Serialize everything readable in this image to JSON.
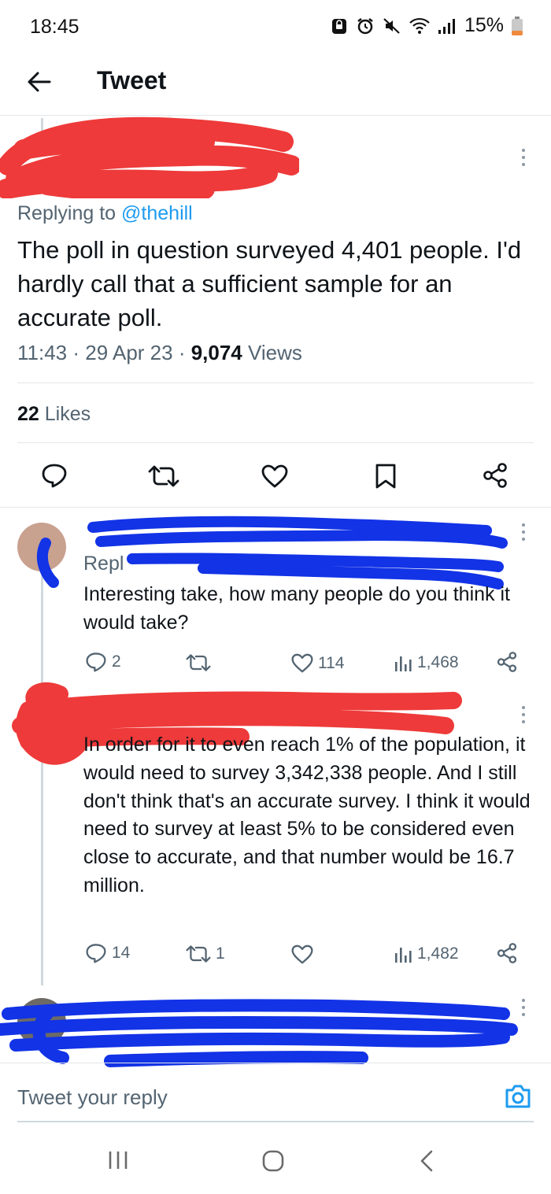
{
  "status_bar": {
    "time": "18:45",
    "battery": "15%",
    "icons": [
      "alarm-lock-icon",
      "alarm-icon",
      "mute-icon",
      "wifi-icon",
      "signal-icon",
      "battery-icon"
    ]
  },
  "header": {
    "title": "Tweet"
  },
  "main_tweet": {
    "replying_prefix": "Replying to ",
    "replying_handle": "@thehill",
    "text": "The poll in question surveyed 4,401 people. I'd hardly call that a sufficient sample for an accurate poll.",
    "time": "11:43",
    "date": "29 Apr 23",
    "views_count": "9,074",
    "views_label": "Views",
    "likes_count": "22",
    "likes_label": "Likes"
  },
  "replies": [
    {
      "replying_prefix": "Repl",
      "text": "Interesting take, how many people do you think it would take?",
      "reply_count": "2",
      "retweet_count": "",
      "like_count": "114",
      "view_count": "1,468"
    },
    {
      "text": "In order for it to even reach 1% of the population, it would need to survey 3,342,338 people. And I still don't think that's an accurate survey. I think it would need to survey at least 5% to be considered even close to accurate, and that number would be 16.7 million.",
      "reply_count": "14",
      "retweet_count": "1",
      "like_count": "",
      "view_count": "1,482"
    }
  ],
  "reply_bar": {
    "placeholder": "Tweet your reply"
  },
  "colors": {
    "accent": "#1d9bf0",
    "text": "#0f1419",
    "muted": "#536471",
    "red_scribble": "#ee3a3a",
    "blue_scribble": "#1233e6"
  }
}
